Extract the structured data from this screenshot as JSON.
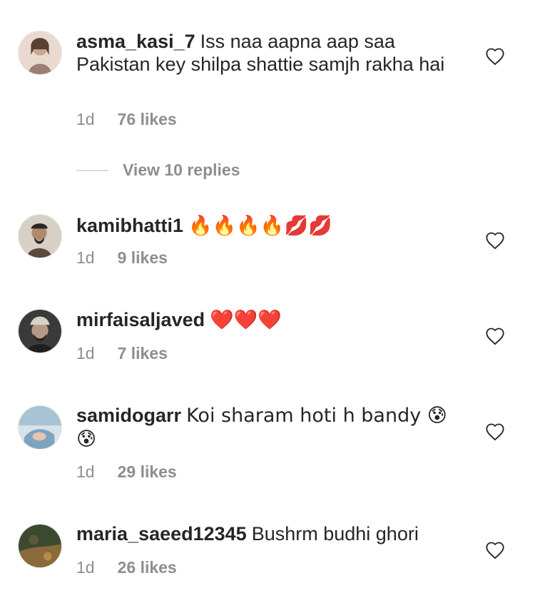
{
  "comments": [
    {
      "username": "asma_kasi_7",
      "text": "Iss naa aapna aap saa Pakistan key shilpa shattie samjh rakha hai",
      "time": "1d",
      "likes": "76 likes",
      "avatar_colors": [
        "#9e7e73",
        "#e9d9cf"
      ]
    },
    {
      "username": "kamibhatti1",
      "text": "🔥🔥🔥🔥💋💋",
      "time": "1d",
      "likes": "9 likes",
      "avatar_colors": [
        "#5a4a3f",
        "#d8cfc6"
      ]
    },
    {
      "username": "mirfaisaljaved",
      "text": "❤️❤️❤️",
      "time": "1d",
      "likes": "7 likes",
      "avatar_colors": [
        "#3a3a3a",
        "#b49a86"
      ]
    },
    {
      "username": "samidogarr",
      "text": "Koi sharam hoti h bandy 😰😰",
      "time": "1d",
      "likes": "29 likes",
      "avatar_colors": [
        "#7da3bf",
        "#d7e2ea"
      ]
    },
    {
      "username": "maria_saeed12345",
      "text": "Bushrm budhi ghori",
      "time": "1d",
      "likes": "26 likes",
      "avatar_colors": [
        "#3b4a2e",
        "#8a6a3a"
      ]
    }
  ],
  "view_replies_label": "View 10 replies",
  "colors": {
    "text": "#262626",
    "secondary": "#8e8e8e",
    "divider": "#dbdbdb"
  },
  "icons": {
    "like": "heart-outline-icon"
  }
}
